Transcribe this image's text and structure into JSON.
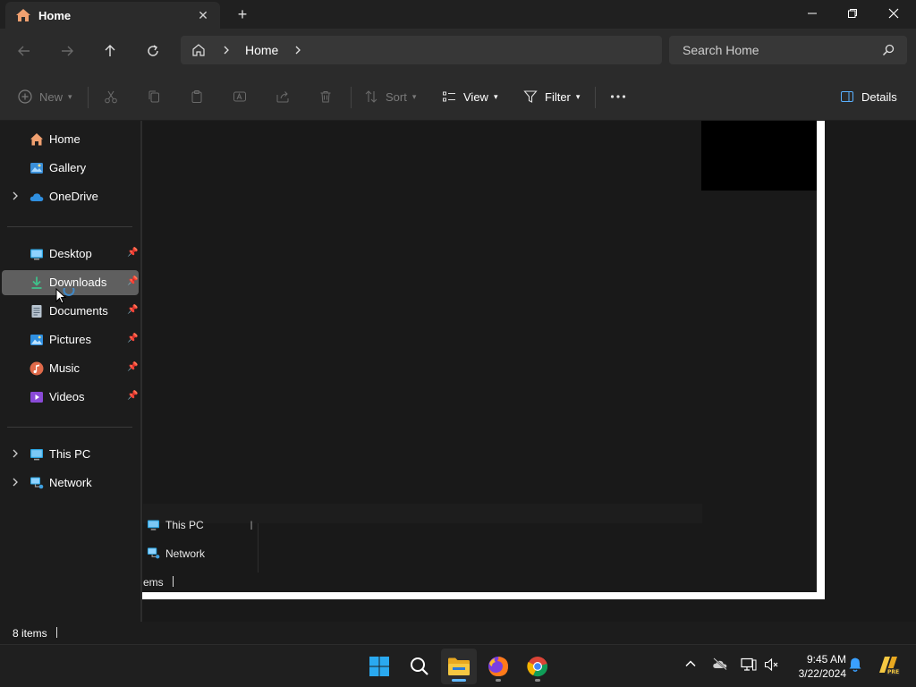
{
  "window": {
    "tab_title": "Home",
    "tab_close": "✕",
    "new_tab": "+"
  },
  "address": {
    "crumb": "Home"
  },
  "search": {
    "placeholder": "Search Home"
  },
  "toolbar": {
    "new_label": "New",
    "sort_label": "Sort",
    "view_label": "View",
    "filter_label": "Filter",
    "details_label": "Details"
  },
  "sidebar": {
    "items": [
      {
        "label": "Home",
        "icon": "home-icon"
      },
      {
        "label": "Gallery",
        "icon": "gallery-icon"
      },
      {
        "label": "OneDrive",
        "icon": "onedrive-icon"
      },
      {
        "label": "Desktop",
        "icon": "desktop-icon"
      },
      {
        "label": "Downloads",
        "icon": "downloads-icon"
      },
      {
        "label": "Documents",
        "icon": "documents-icon"
      },
      {
        "label": "Pictures",
        "icon": "pictures-icon"
      },
      {
        "label": "Music",
        "icon": "music-icon"
      },
      {
        "label": "Videos",
        "icon": "videos-icon"
      },
      {
        "label": "This PC",
        "icon": "this-pc-icon"
      },
      {
        "label": "Network",
        "icon": "network-icon"
      }
    ],
    "selected": "Downloads"
  },
  "ghost": {
    "this_pc": "This PC",
    "network": "Network",
    "status": "ems"
  },
  "status": {
    "count": "8 items"
  },
  "clock": {
    "time": "9:45 AM",
    "date": "3/22/2024"
  },
  "colors": {
    "accent": "#0078d4",
    "folder": "#f0c040",
    "selected_bg": "#5f5f5f"
  }
}
